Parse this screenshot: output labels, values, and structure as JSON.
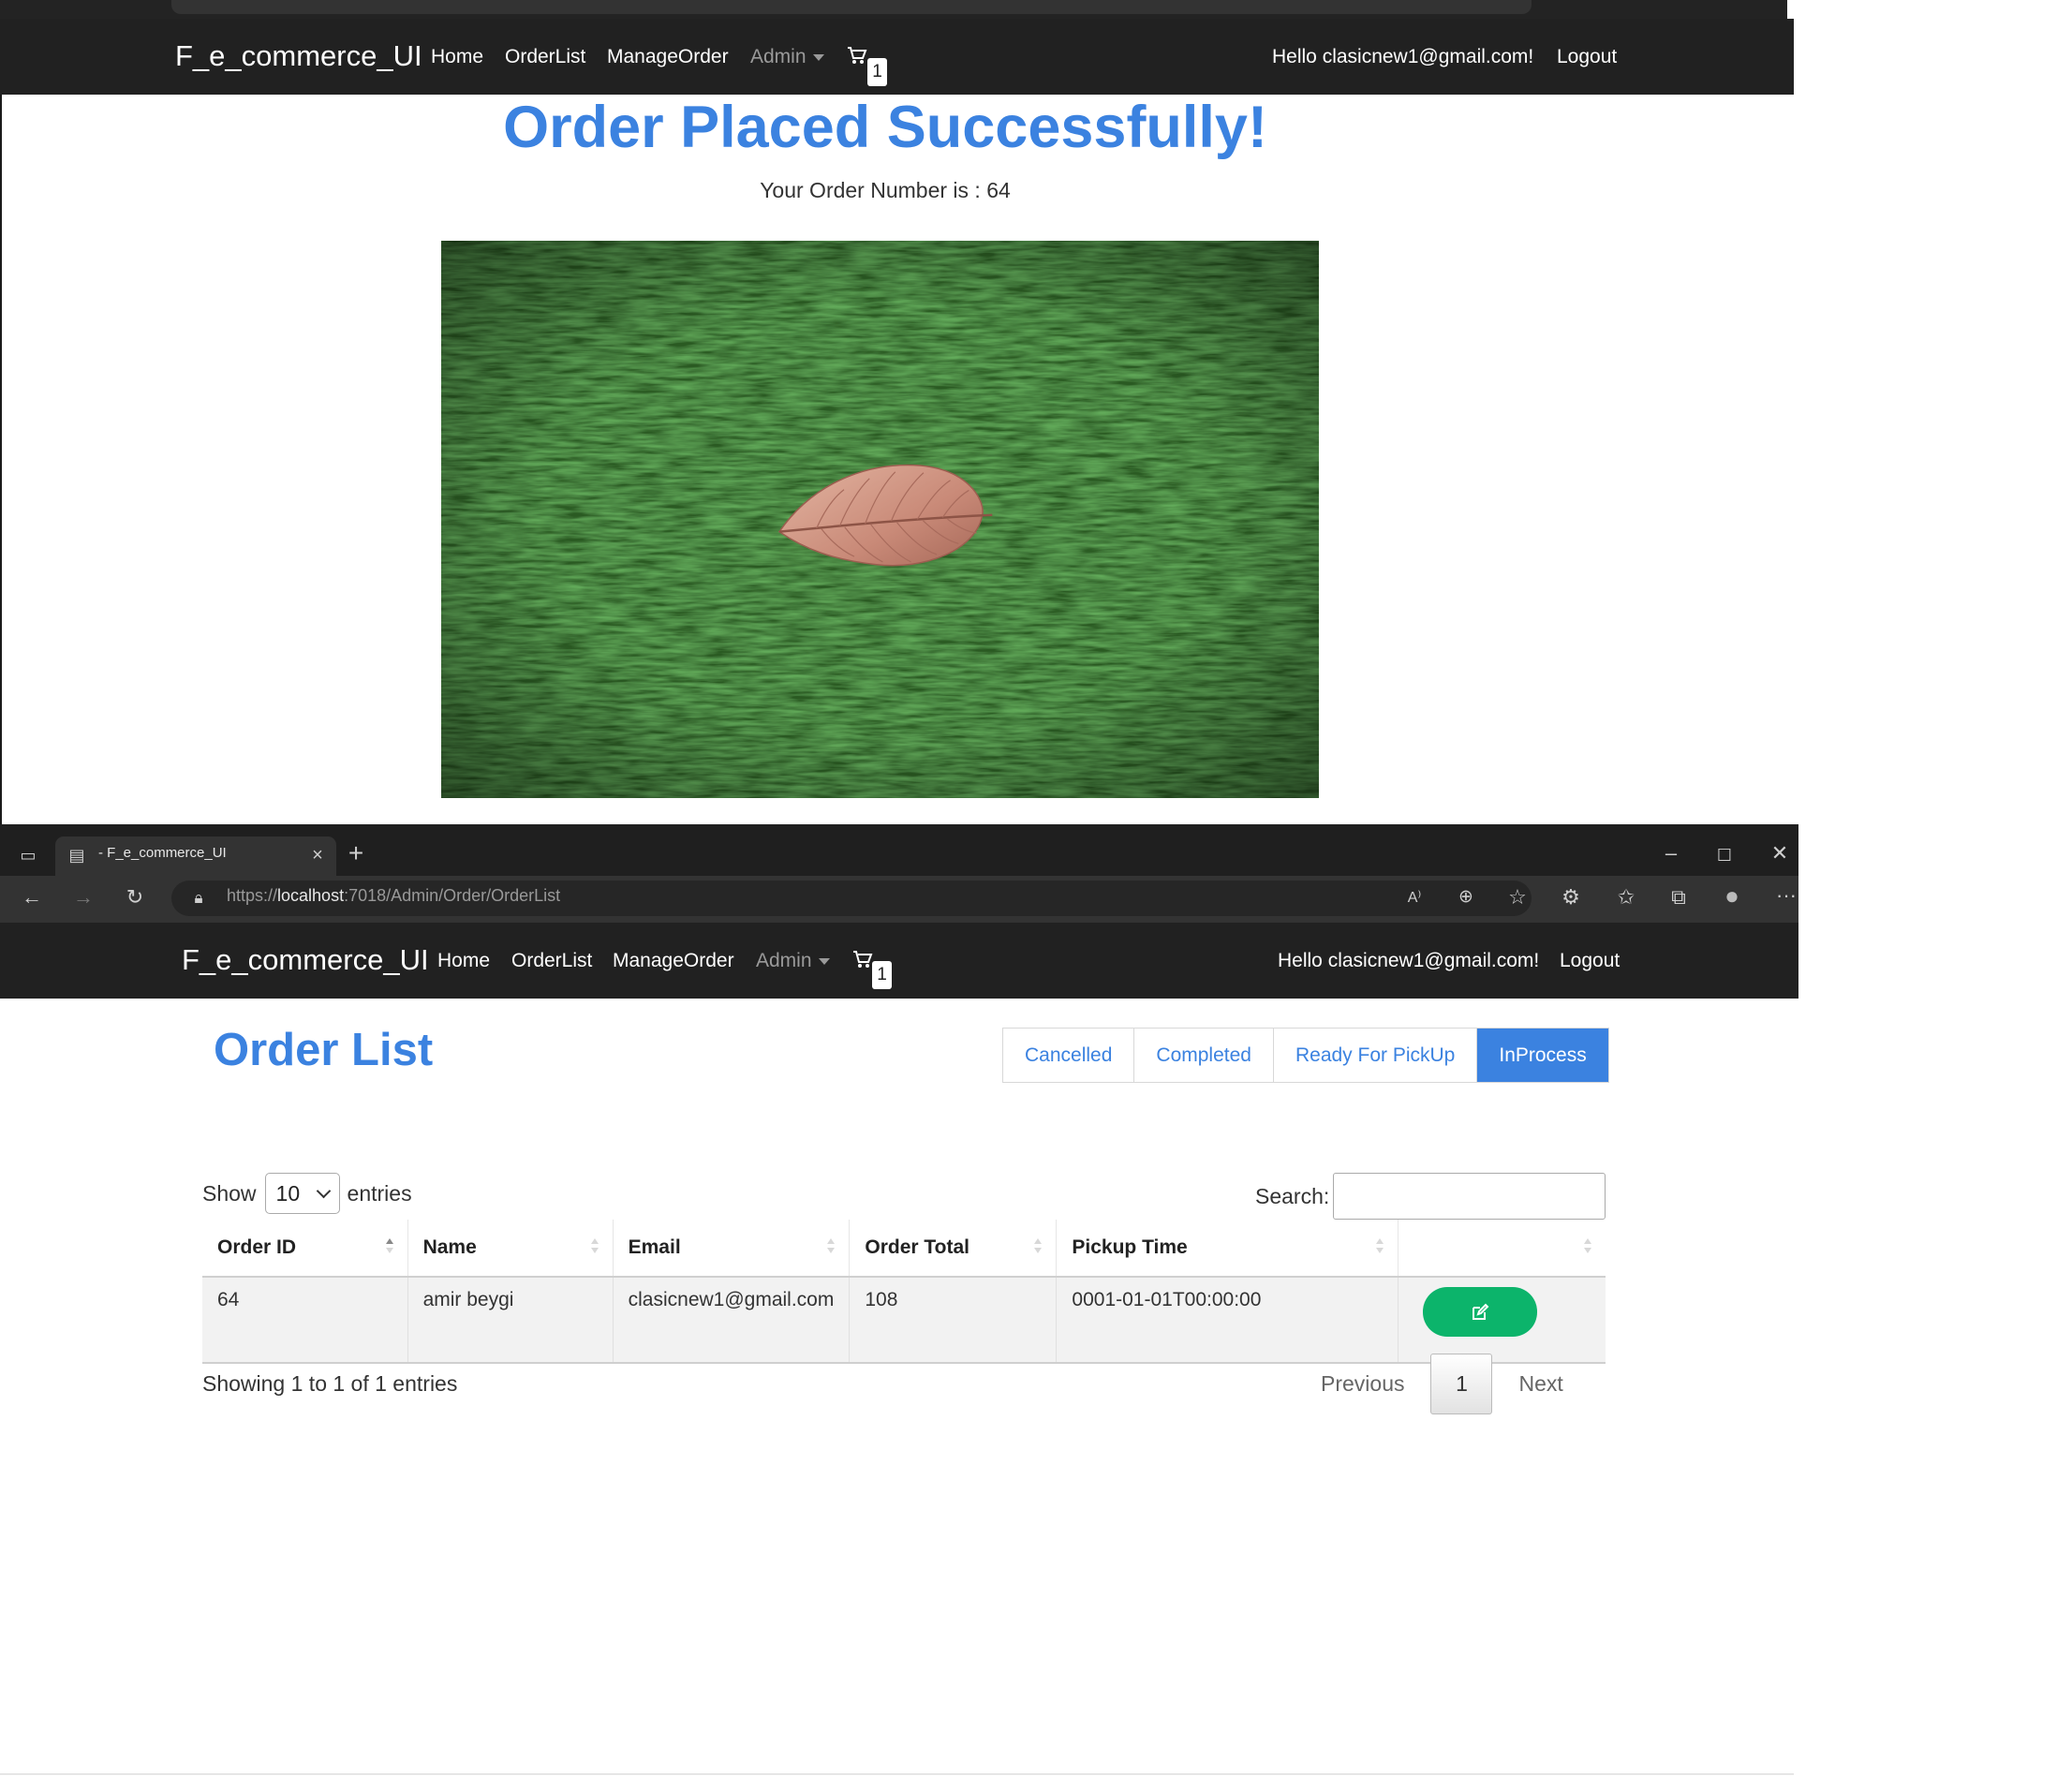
{
  "navbar": {
    "brand": "F_e_commerce_UI",
    "links": {
      "home": "Home",
      "order_list": "OrderList",
      "manage_order": "ManageOrder",
      "admin": "Admin"
    },
    "cart_count": "1",
    "greeting": "Hello clasicnew1@gmail.com!",
    "logout": "Logout"
  },
  "confirmation": {
    "heading": "Order Placed Successfully!",
    "order_number_text": "Your Order Number is : 64"
  },
  "browser": {
    "tab_title": "- F_e_commerce_UI",
    "url_scheme": "https://",
    "url_host": "localhost",
    "url_rest": ":7018/Admin/Order/OrderList",
    "new_tab": "+",
    "more": "···"
  },
  "order_list": {
    "title": "Order List",
    "filters": [
      "Cancelled",
      "Completed",
      "Ready For PickUp",
      "InProcess"
    ],
    "active_filter": "InProcess",
    "show_label": "Show",
    "entries_value": "10",
    "entries_label": "entries",
    "search_label": "Search:",
    "columns": [
      "Order ID",
      "Name",
      "Email",
      "Order Total",
      "Pickup Time",
      ""
    ],
    "rows": [
      {
        "order_id": "64",
        "name": "amir beygi",
        "email": "clasicnew1@gmail.com",
        "order_total": "108",
        "pickup_time": "0001-01-01T00:00:00"
      }
    ],
    "info": "Showing 1 to 1 of 1 entries",
    "pagination": {
      "previous": "Previous",
      "current": "1",
      "next": "Next"
    }
  },
  "colors": {
    "accent": "#3b82e0",
    "navbar_bg": "#212121",
    "edit_button": "#0cb46b"
  }
}
